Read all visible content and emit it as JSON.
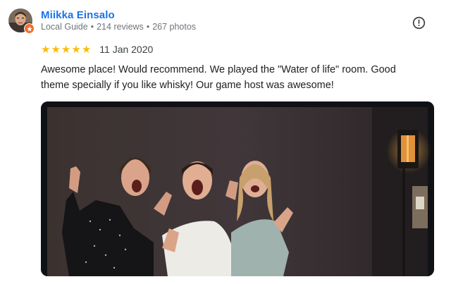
{
  "reviewer": {
    "name": "Miikka Einsalo",
    "badge": "Local Guide",
    "reviews": "214 reviews",
    "photos": "267 photos",
    "separator": "•"
  },
  "review": {
    "rating": 5,
    "rating_max": 5,
    "stars": [
      "★",
      "★",
      "★",
      "★",
      "★"
    ],
    "date": "11 Jan 2020",
    "text": "Awesome place! Would recommend. We played the \"Water of life\" room. Good theme specially if you like whisky! Our game host was awesome!"
  },
  "icons": {
    "report": "exclamation-circle-icon",
    "local_guide": "local-guide-badge-icon"
  },
  "colors": {
    "name_link": "#1a73e8",
    "star": "#fbbc04",
    "badge": "#f2702c",
    "meta_text": "#70757a",
    "photo_background": "#3a312f"
  }
}
